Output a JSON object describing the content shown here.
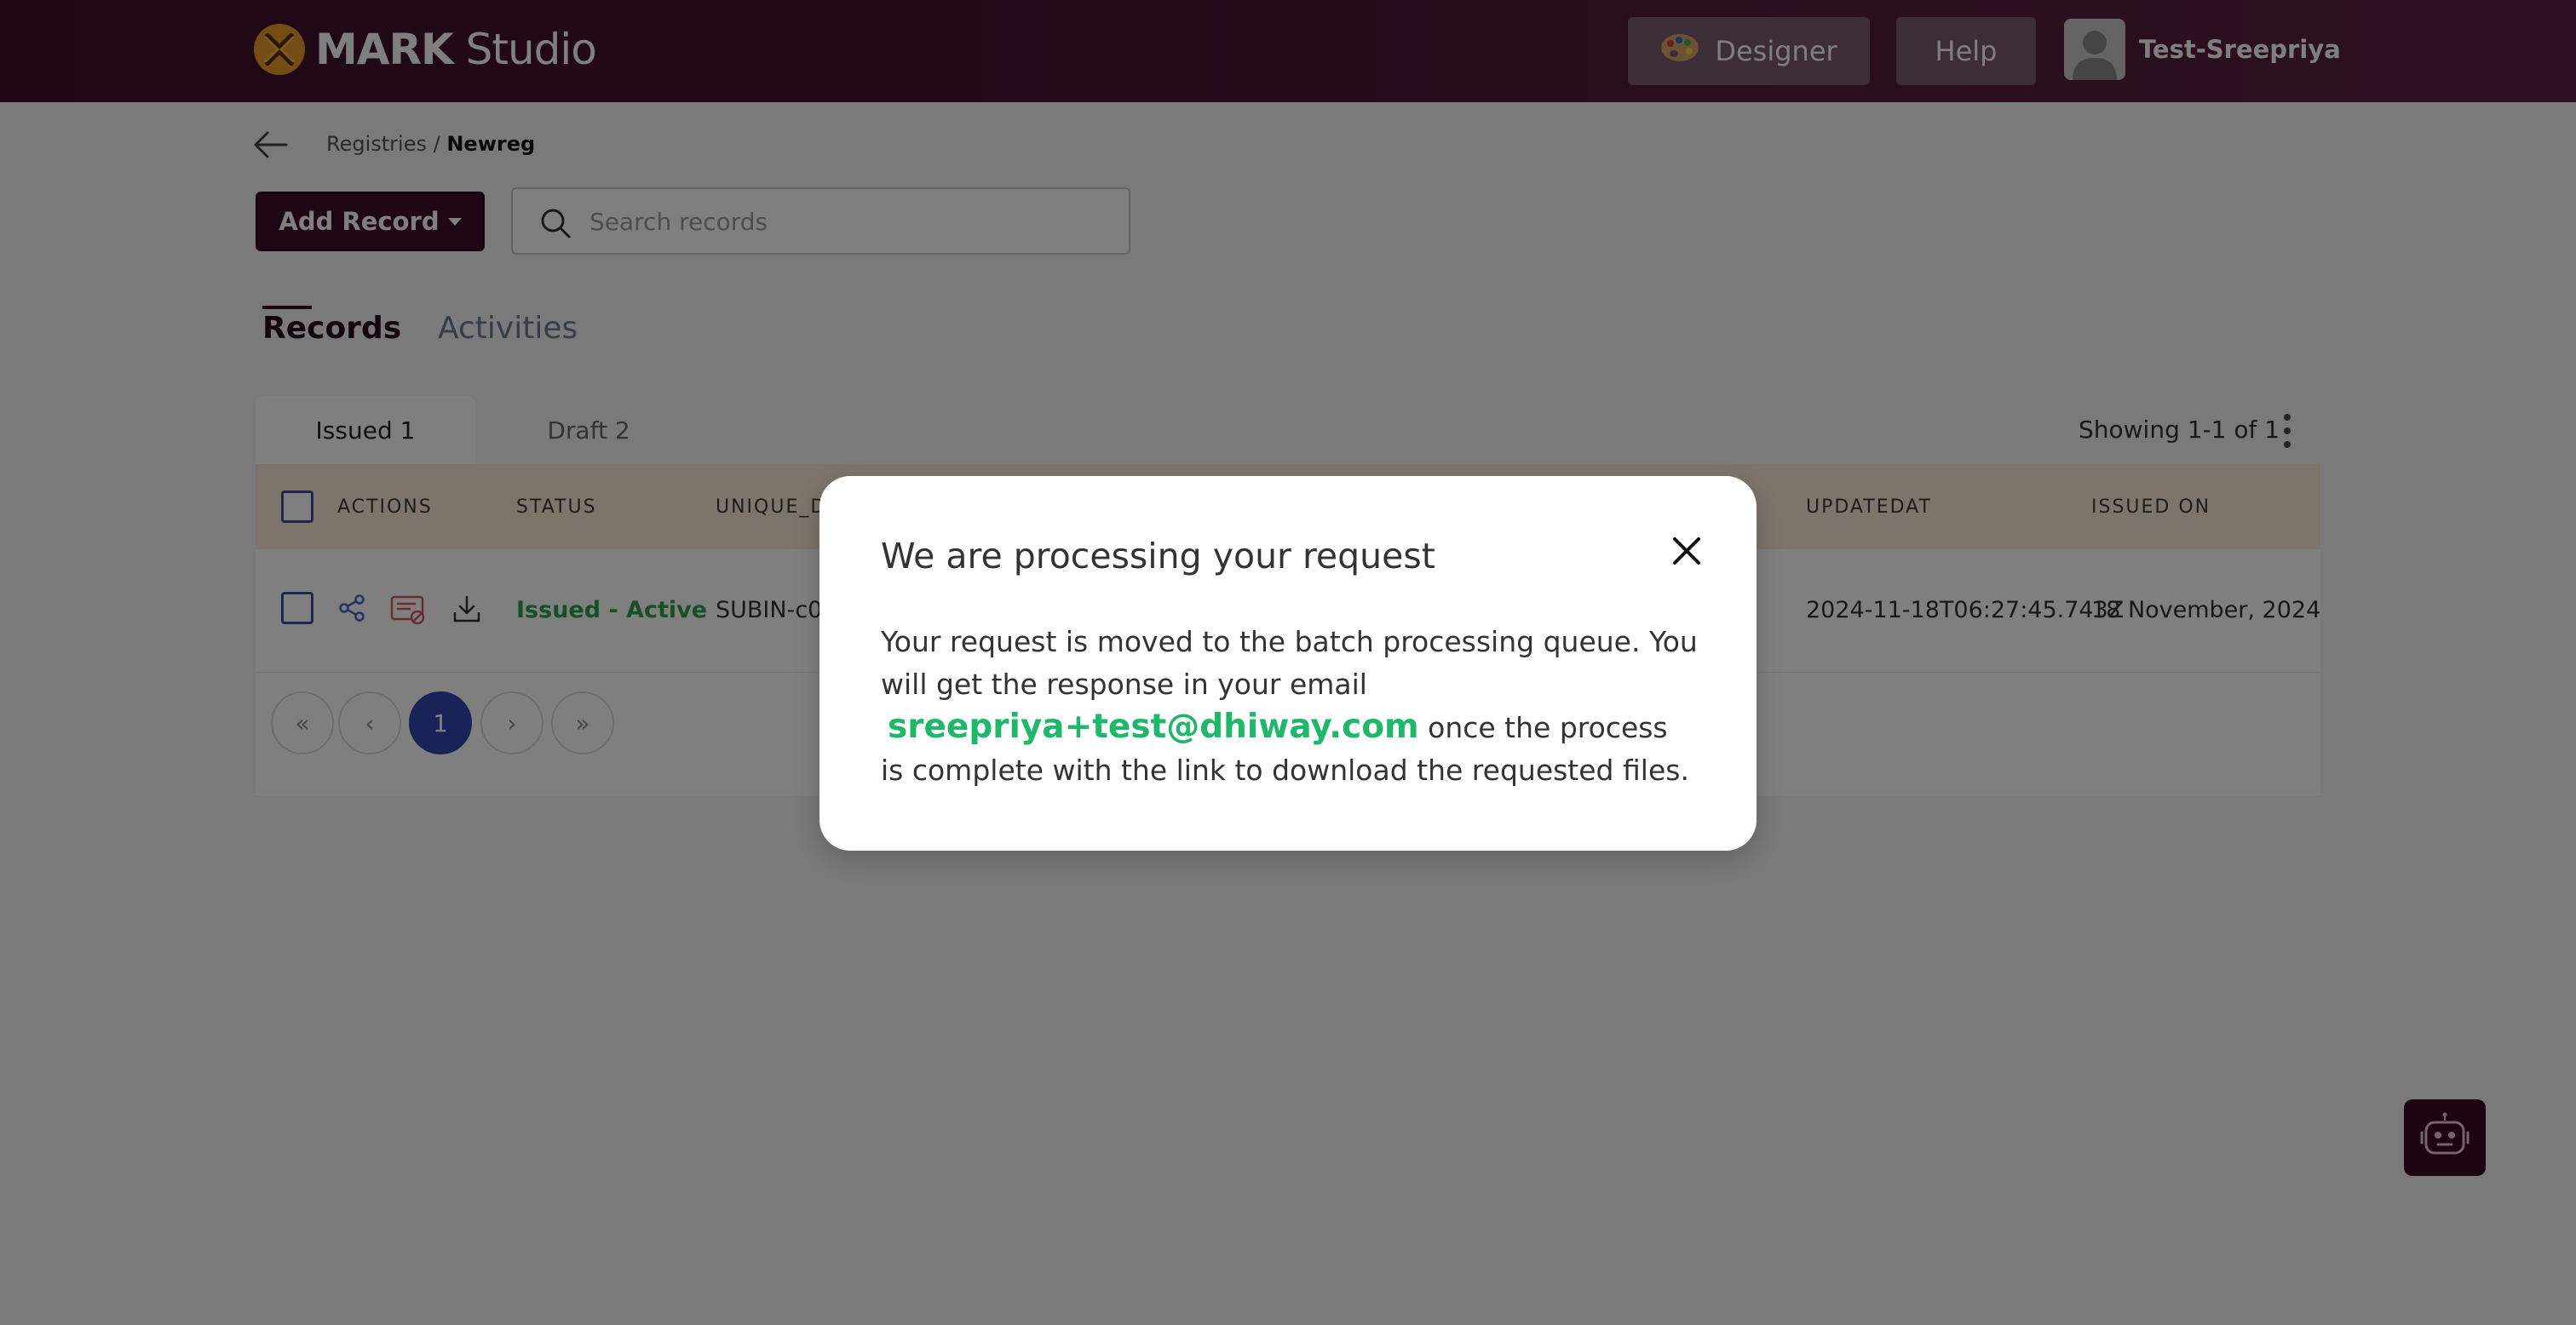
{
  "app": {
    "logo_bold": "MARK",
    "logo_light": "Studio"
  },
  "nav": {
    "designer_label": "Designer",
    "help_label": "Help",
    "user_name": "Test-Sreepriya"
  },
  "breadcrumb": {
    "parent": "Registries",
    "separator": " / ",
    "current": "Newreg"
  },
  "toolbar": {
    "add_record_label": "Add Record",
    "search_placeholder": "Search records"
  },
  "tabs": [
    {
      "label": "Records",
      "active": true
    },
    {
      "label": "Activities",
      "active": false
    }
  ],
  "subtabs": [
    {
      "label": "Issued 1",
      "active": true
    },
    {
      "label": "Draft 2",
      "active": false
    }
  ],
  "showing_text": "Showing 1-1 of 1",
  "table": {
    "columns": [
      "ACTIONS",
      "STATUS",
      "UNIQUE_D",
      "UPDATEDAT",
      "ISSUED ON"
    ],
    "rows": [
      {
        "status": "Issued - Active",
        "unique_id": "SUBIN-c0",
        "updatedat": "2024-11-18T06:27:45.743Z",
        "issued_on": "18 November, 2024"
      }
    ]
  },
  "pagination": {
    "current_page": "1"
  },
  "modal": {
    "title": "We are processing your request",
    "body_before": "Your request is moved to the batch processing queue. You will get the response in your email",
    "email": "sreepriya+test@dhiway.com",
    "body_after": " once the process is complete with the link to download the requested files."
  },
  "colors": {
    "brand": "#3e0d29",
    "accent_green": "#1fb86a",
    "page_active": "#3347b0"
  },
  "icons": [
    "logo-icon",
    "palette-icon",
    "avatar-icon",
    "back-arrow-icon",
    "search-icon",
    "share-icon",
    "certificate-icon",
    "download-icon",
    "first-page-icon",
    "prev-page-icon",
    "next-page-icon",
    "last-page-icon",
    "close-icon",
    "chatbot-icon",
    "kebab-menu-icon"
  ]
}
